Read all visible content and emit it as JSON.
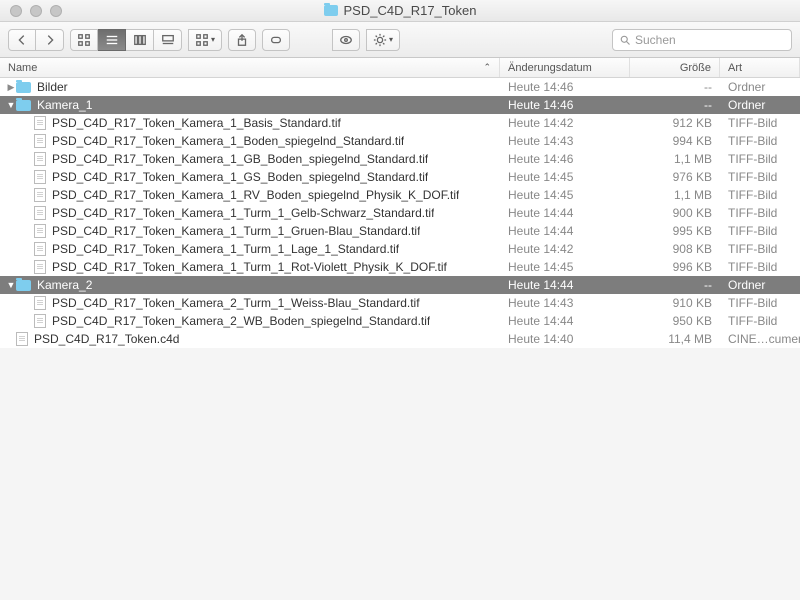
{
  "window": {
    "title": "PSD_C4D_R17_Token"
  },
  "search": {
    "placeholder": "Suchen"
  },
  "columns": {
    "name": "Name",
    "date": "Änderungsdatum",
    "size": "Größe",
    "kind": "Art"
  },
  "rows": [
    {
      "type": "folder",
      "expanded": false,
      "selected": false,
      "indent": 0,
      "name": "Bilder",
      "date": "Heute 14:46",
      "size": "--",
      "kind": "Ordner"
    },
    {
      "type": "folder",
      "expanded": true,
      "selected": true,
      "indent": 0,
      "name": "Kamera_1",
      "date": "Heute 14:46",
      "size": "--",
      "kind": "Ordner"
    },
    {
      "type": "file",
      "indent": 1,
      "name": "PSD_C4D_R17_Token_Kamera_1_Basis_Standard.tif",
      "date": "Heute 14:42",
      "size": "912 KB",
      "kind": "TIFF-Bild"
    },
    {
      "type": "file",
      "indent": 1,
      "name": "PSD_C4D_R17_Token_Kamera_1_Boden_spiegelnd_Standard.tif",
      "date": "Heute 14:43",
      "size": "994 KB",
      "kind": "TIFF-Bild"
    },
    {
      "type": "file",
      "indent": 1,
      "name": "PSD_C4D_R17_Token_Kamera_1_GB_Boden_spiegelnd_Standard.tif",
      "date": "Heute 14:46",
      "size": "1,1 MB",
      "kind": "TIFF-Bild"
    },
    {
      "type": "file",
      "indent": 1,
      "name": "PSD_C4D_R17_Token_Kamera_1_GS_Boden_spiegelnd_Standard.tif",
      "date": "Heute 14:45",
      "size": "976 KB",
      "kind": "TIFF-Bild"
    },
    {
      "type": "file",
      "indent": 1,
      "name": "PSD_C4D_R17_Token_Kamera_1_RV_Boden_spiegelnd_Physik_K_DOF.tif",
      "date": "Heute 14:45",
      "size": "1,1 MB",
      "kind": "TIFF-Bild"
    },
    {
      "type": "file",
      "indent": 1,
      "name": "PSD_C4D_R17_Token_Kamera_1_Turm_1_Gelb-Schwarz_Standard.tif",
      "date": "Heute 14:44",
      "size": "900 KB",
      "kind": "TIFF-Bild"
    },
    {
      "type": "file",
      "indent": 1,
      "name": "PSD_C4D_R17_Token_Kamera_1_Turm_1_Gruen-Blau_Standard.tif",
      "date": "Heute 14:44",
      "size": "995 KB",
      "kind": "TIFF-Bild"
    },
    {
      "type": "file",
      "indent": 1,
      "name": "PSD_C4D_R17_Token_Kamera_1_Turm_1_Lage_1_Standard.tif",
      "date": "Heute 14:42",
      "size": "908 KB",
      "kind": "TIFF-Bild"
    },
    {
      "type": "file",
      "indent": 1,
      "name": "PSD_C4D_R17_Token_Kamera_1_Turm_1_Rot-Violett_Physik_K_DOF.tif",
      "date": "Heute 14:45",
      "size": "996 KB",
      "kind": "TIFF-Bild"
    },
    {
      "type": "folder",
      "expanded": true,
      "selected": true,
      "indent": 0,
      "name": "Kamera_2",
      "date": "Heute 14:44",
      "size": "--",
      "kind": "Ordner"
    },
    {
      "type": "file",
      "indent": 1,
      "name": "PSD_C4D_R17_Token_Kamera_2_Turm_1_Weiss-Blau_Standard.tif",
      "date": "Heute 14:43",
      "size": "910 KB",
      "kind": "TIFF-Bild"
    },
    {
      "type": "file",
      "indent": 1,
      "name": "PSD_C4D_R17_Token_Kamera_2_WB_Boden_spiegelnd_Standard.tif",
      "date": "Heute 14:44",
      "size": "950 KB",
      "kind": "TIFF-Bild"
    },
    {
      "type": "file",
      "indent": 0,
      "name": "PSD_C4D_R17_Token.c4d",
      "date": "Heute 14:40",
      "size": "11,4 MB",
      "kind": "CINE…cument"
    }
  ]
}
